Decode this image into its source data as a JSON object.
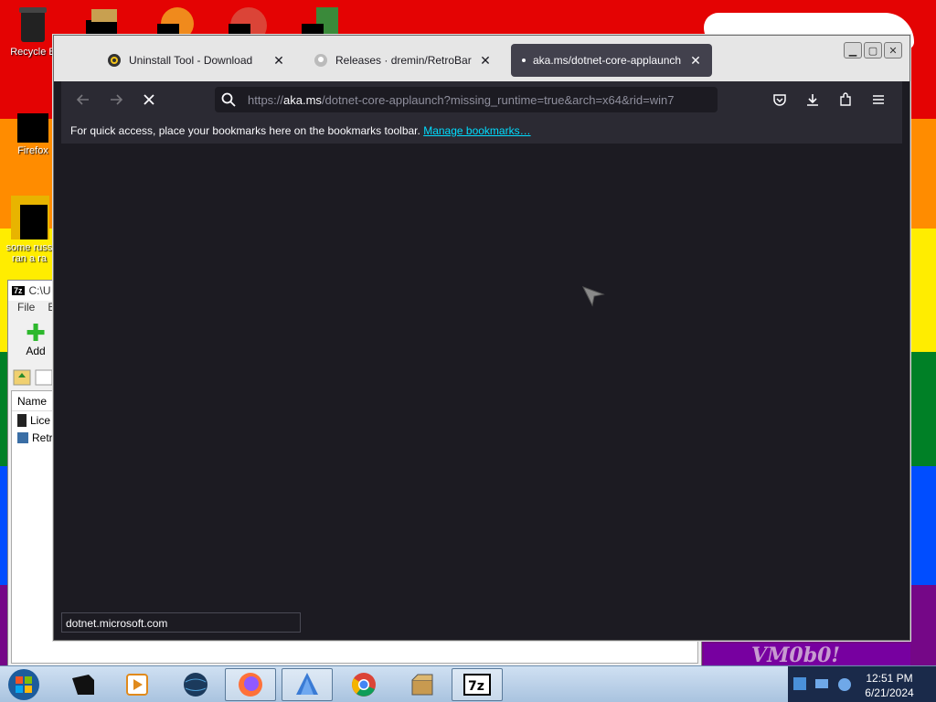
{
  "desktop": {
    "icons": [
      {
        "label": "Recycle B",
        "icon": "recycle-bin-icon"
      },
      {
        "label": "Firefox",
        "icon": "firefox-icon"
      },
      {
        "label": "some russ",
        "label2": "ran a ra",
        "icon": "file-icon"
      }
    ],
    "watermark": "VM0b0!"
  },
  "sevenzip": {
    "title": "C:\\U",
    "menu": [
      "File",
      "E"
    ],
    "toolbar_add": "Add",
    "column_name": "Name",
    "rows": [
      "Lice",
      "Retr"
    ]
  },
  "browser": {
    "tabs": [
      {
        "label": "Uninstall Tool - Download",
        "favicon": "uninstall-tool-icon"
      },
      {
        "label": "Releases · dremin/RetroBar",
        "favicon": "github-icon"
      },
      {
        "label": "aka.ms/dotnet-core-applaunch",
        "favicon": "loading-dot-icon"
      }
    ],
    "url_prefix": "https://",
    "url_host": "aka.ms",
    "url_rest": "/dotnet-core-applaunch?missing_runtime=true&arch=x64&rid=win7",
    "bookmarks_text": "For quick access, place your bookmarks here on the bookmarks toolbar.",
    "bookmarks_link": "Manage bookmarks…",
    "status_text": "dotnet.microsoft.com",
    "icons": [
      "back-icon",
      "forward-icon",
      "stop-icon",
      "search-icon",
      "pocket-icon",
      "download-icon",
      "extensions-icon",
      "menu-icon"
    ]
  },
  "taskbar": {
    "apps": [
      "task-app-icon",
      "media-player-icon",
      "globe-icon",
      "firefox-icon",
      "retrobar-icon",
      "chrome-icon",
      "package-icon",
      "7zip-icon"
    ],
    "time": "12:51 PM",
    "date": "6/21/2024"
  },
  "colors": {
    "browser_bg": "#1c1b22",
    "toolbar_bg": "#2b2a33",
    "link": "#00ddff"
  }
}
